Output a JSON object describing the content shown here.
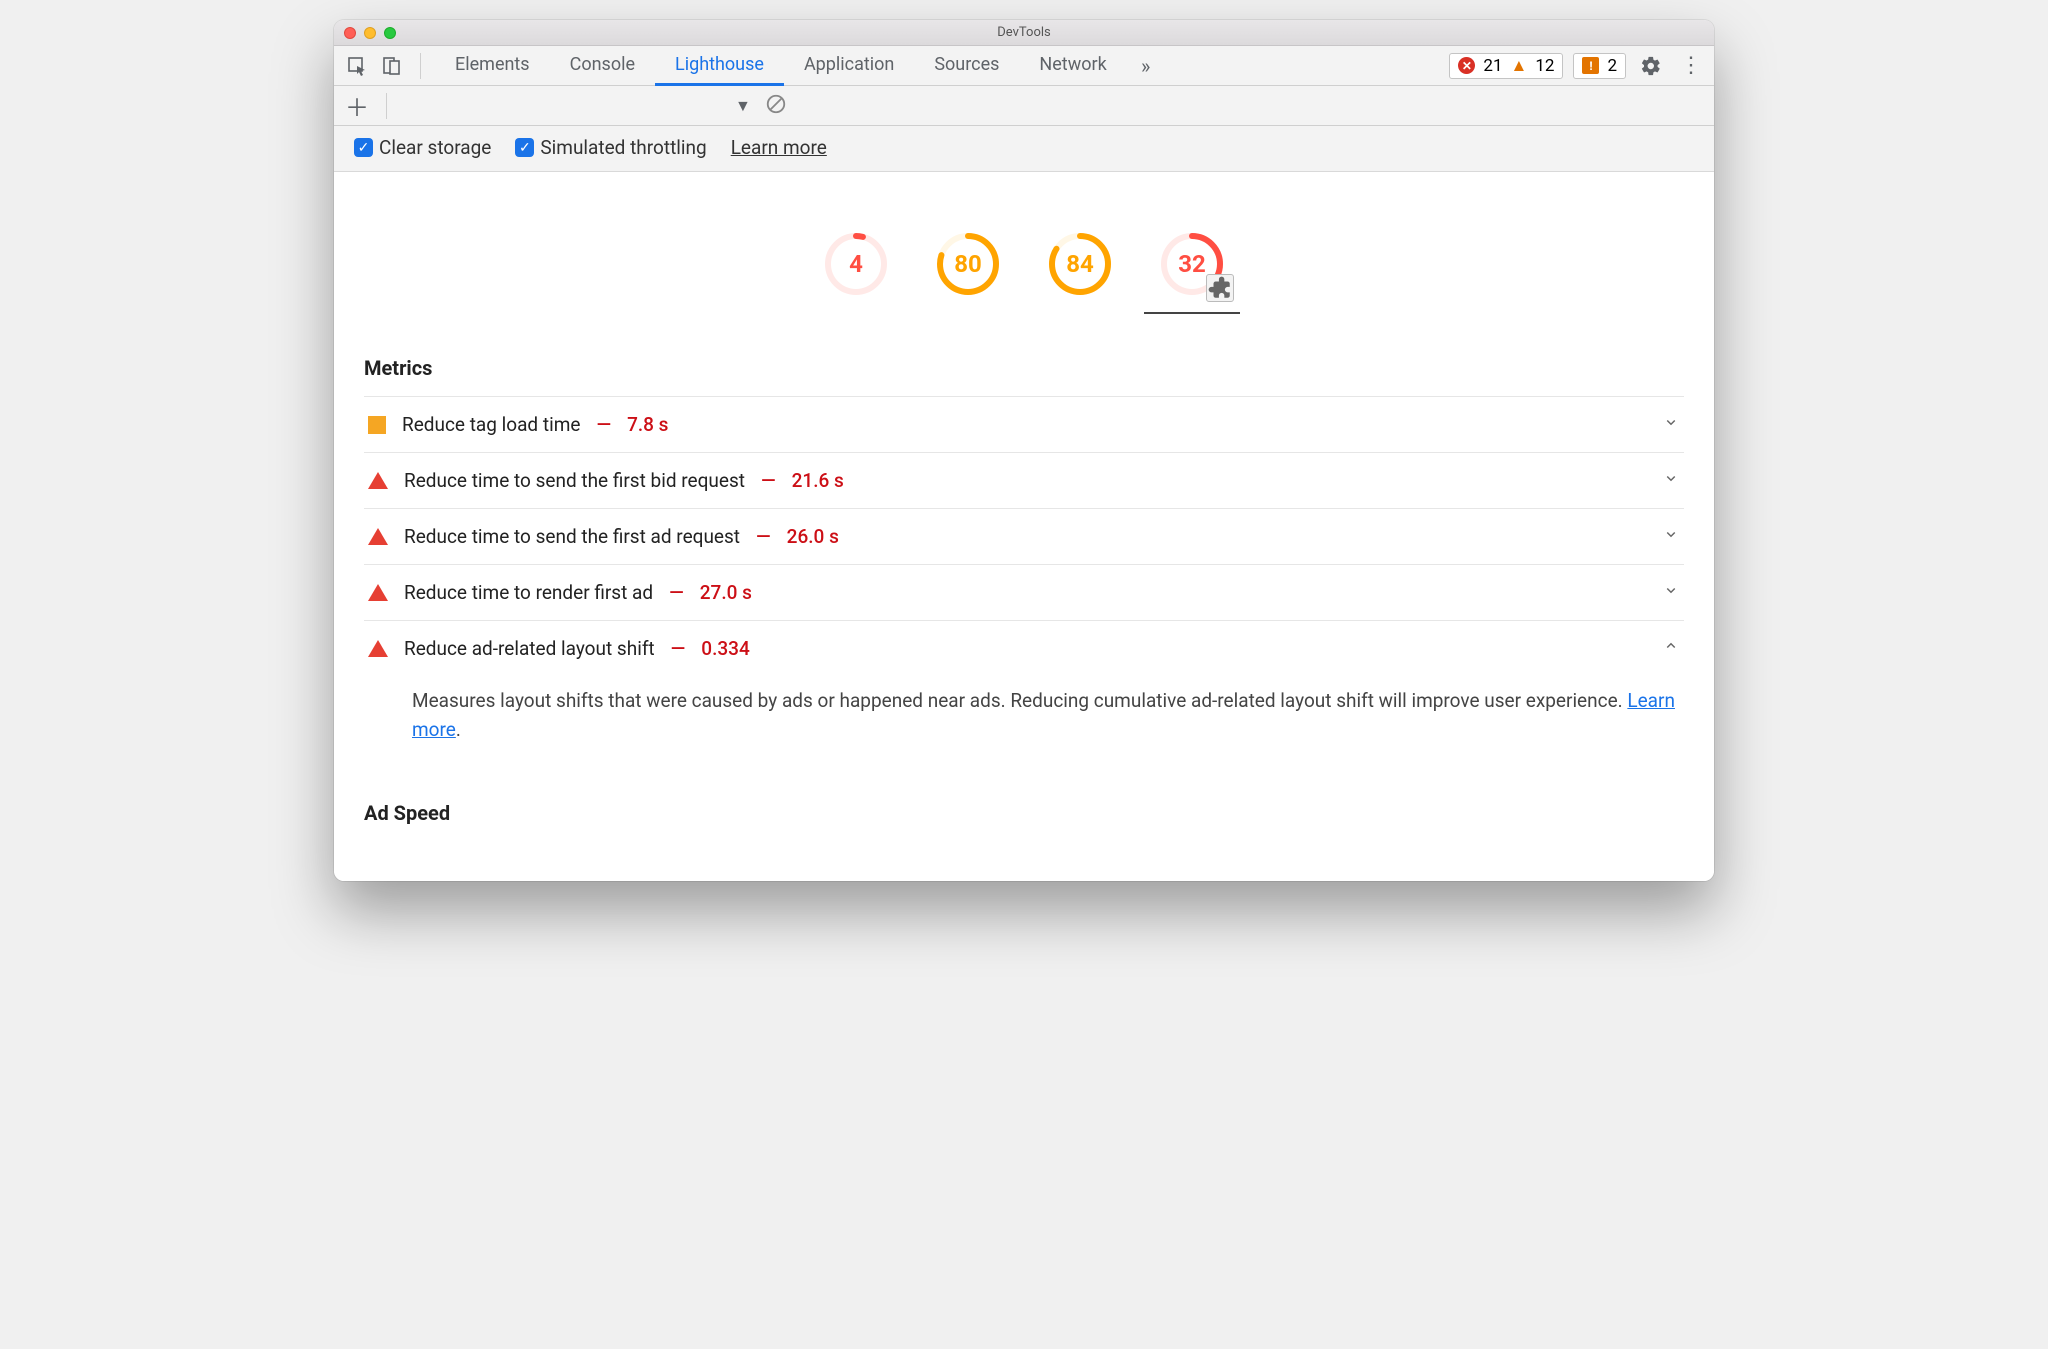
{
  "window": {
    "title": "DevTools"
  },
  "tabs": {
    "items": [
      "Elements",
      "Console",
      "Lighthouse",
      "Application",
      "Sources",
      "Network"
    ],
    "active": "Lighthouse"
  },
  "counters": {
    "errors": "21",
    "warnings": "12",
    "issues": "2"
  },
  "options": {
    "clear_storage": "Clear storage",
    "simulated_throttling": "Simulated throttling",
    "learn_more": "Learn more"
  },
  "scores": [
    {
      "value": 4,
      "color": "#ff4e42",
      "bg": "#ffe9e7"
    },
    {
      "value": 80,
      "color": "#ffa400",
      "bg": "#fff7e6"
    },
    {
      "value": 84,
      "color": "#ffa400",
      "bg": "#fff7e6"
    },
    {
      "value": 32,
      "color": "#ff4e42",
      "bg": "#ffe9e7",
      "selected": true,
      "plugin": true
    }
  ],
  "sections": {
    "metrics_title": "Metrics",
    "ad_speed_title": "Ad Speed"
  },
  "metrics": [
    {
      "icon": "square",
      "label": "Reduce tag load time",
      "value": "7.8 s",
      "expanded": false
    },
    {
      "icon": "tri",
      "label": "Reduce time to send the first bid request",
      "value": "21.6 s",
      "expanded": false
    },
    {
      "icon": "tri",
      "label": "Reduce time to send the first ad request",
      "value": "26.0 s",
      "expanded": false
    },
    {
      "icon": "tri",
      "label": "Reduce time to render first ad",
      "value": "27.0 s",
      "expanded": false
    },
    {
      "icon": "tri",
      "label": "Reduce ad-related layout shift",
      "value": "0.334",
      "expanded": true,
      "desc": "Measures layout shifts that were caused by ads or happened near ads. Reducing cumulative ad-related layout shift will improve user experience. ",
      "desc_link": "Learn more"
    }
  ]
}
